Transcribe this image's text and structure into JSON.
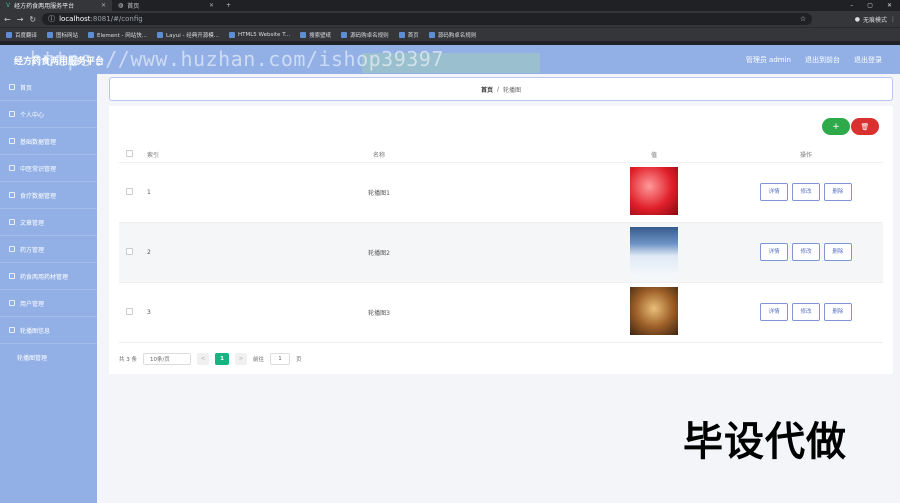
{
  "browser": {
    "tabs": [
      {
        "label": "经方药食两用服务平台",
        "active": true
      },
      {
        "label": "首页",
        "active": false
      }
    ],
    "address": {
      "host": "localhost",
      "path": ":8081/#/config"
    },
    "incognito_label": "无痕模式",
    "bookmarks": [
      {
        "label": "百度翻译"
      },
      {
        "label": "图标网站"
      },
      {
        "label": "Element - 网站快..."
      },
      {
        "label": "Layui - 经典开源模..."
      },
      {
        "label": "HTML5 Website T..."
      },
      {
        "label": "搜索壁纸"
      },
      {
        "label": "源码购卓名规则"
      },
      {
        "label": "首页"
      },
      {
        "label": "源码购卓名规则"
      }
    ]
  },
  "header": {
    "title": "经方药食两用服务平台",
    "admin_label": "管理员 admin",
    "front_link": "退出到前台",
    "logout_link": "退出登录"
  },
  "watermark": {
    "text": "https://www.huzhan.com/ishop39397",
    "big_text": "毕设代做"
  },
  "sidebar": {
    "items": [
      {
        "label": "首页"
      },
      {
        "label": "个人中心"
      },
      {
        "label": "基础数据管理"
      },
      {
        "label": "中医常识管理"
      },
      {
        "label": "食疗数据管理"
      },
      {
        "label": "文章管理"
      },
      {
        "label": "药方管理"
      },
      {
        "label": "药食两用药材管理"
      },
      {
        "label": "用户管理"
      },
      {
        "label": "轮播图信息"
      },
      {
        "label": "轮播图管理"
      }
    ]
  },
  "breadcrumb": {
    "home": "首页",
    "separator": "/",
    "current": "轮播图"
  },
  "toolbar": {
    "add_icon": "+",
    "delete_icon": "🗑"
  },
  "table": {
    "headers": [
      "索引",
      "名称",
      "值",
      "操作"
    ],
    "rows": [
      {
        "index": "1",
        "name": "轮播图1",
        "image": "red-abstract"
      },
      {
        "index": "2",
        "name": "轮播图2",
        "image": "mountain-sky"
      },
      {
        "index": "3",
        "name": "轮播图3",
        "image": "corridor"
      }
    ],
    "actions": [
      "详情",
      "修改",
      "删除"
    ]
  },
  "pagination": {
    "total": "共 3 条",
    "page_size": "10条/页",
    "prev": "<",
    "current": "1",
    "next": ">",
    "goto_label": "前往",
    "goto_value": "1",
    "page_suffix": "页"
  }
}
